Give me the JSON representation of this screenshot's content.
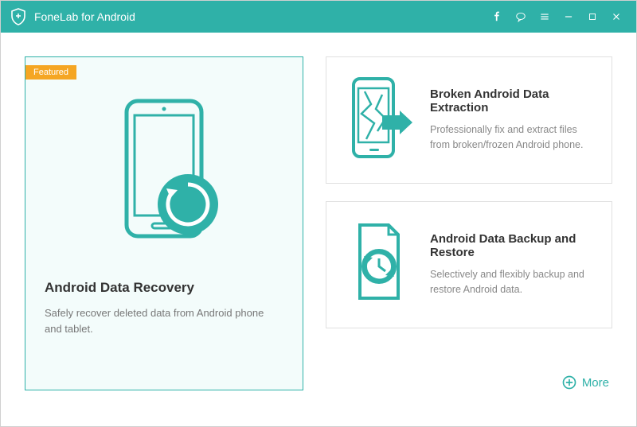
{
  "app": {
    "title": "FoneLab for Android"
  },
  "colors": {
    "accent": "#2fb1a8",
    "badge": "#f5a623"
  },
  "featured_badge": "Featured",
  "cards": {
    "recovery": {
      "title": "Android Data Recovery",
      "desc": "Safely recover deleted data from Android phone and tablet."
    },
    "extraction": {
      "title": "Broken Android Data Extraction",
      "desc": "Professionally fix and extract files from broken/frozen Android phone."
    },
    "backup": {
      "title": "Android Data Backup and Restore",
      "desc": "Selectively and flexibly backup and restore Android data."
    }
  },
  "more_label": "More"
}
